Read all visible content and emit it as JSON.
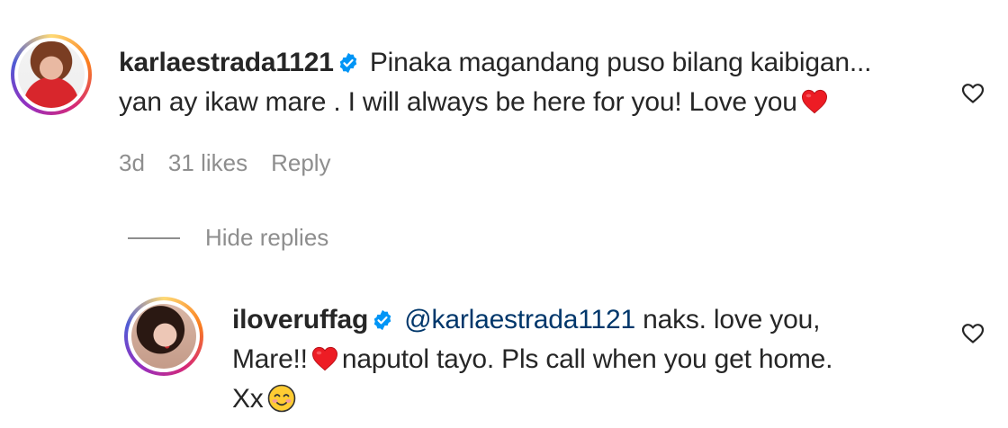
{
  "comment": {
    "username": "karlaestrada1121",
    "text_line1": "Pinaka magandang puso bilang kaibigan...",
    "text_line2": "yan ay ikaw mare . I will always be here for you! Love you",
    "time": "3d",
    "likes": "31 likes",
    "reply_label": "Reply",
    "verified_icon": "verified-badge-icon",
    "colors": {
      "verified": "#0095f6",
      "heart": "#ed1c24"
    }
  },
  "replies_toggle": {
    "label": "Hide replies"
  },
  "reply": {
    "username": "iloveruffag",
    "mention": "@karlaestrada1121",
    "text_part1": "naks. love you,",
    "text_part2": "Mare!!",
    "text_part3": "naputol tayo. Pls call when you get home.",
    "text_part4": "Xx",
    "verified_icon": "verified-badge-icon"
  }
}
